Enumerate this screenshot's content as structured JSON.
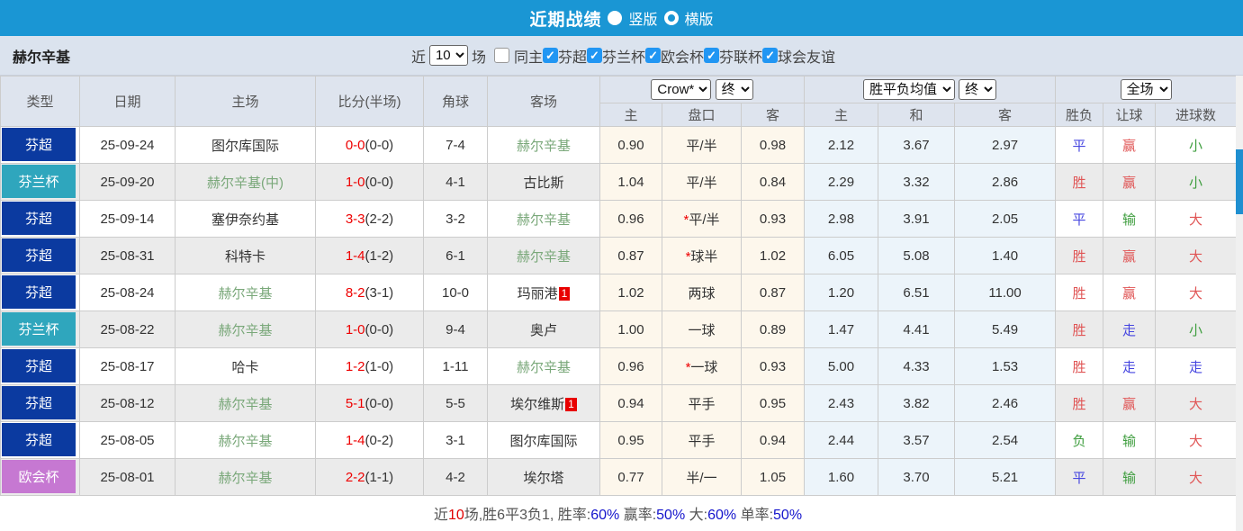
{
  "title_bar": {
    "title": "近期战绩",
    "vertical_label": "竖版",
    "horizontal_label": "横版"
  },
  "filter": {
    "team": "赫尔辛基",
    "recent_label": "近",
    "recent_value": "10",
    "matches_label": "场",
    "same_home_label": "同主",
    "leagues": [
      "芬超",
      "芬兰杯",
      "欧会杯",
      "芬联杯",
      "球会友谊"
    ]
  },
  "colors": {
    "title_bar_bg": "#1a96d4",
    "league_chao_bg": "#0b3aa0",
    "league_bei_bg": "#2fa6bd",
    "league_ou_bg": "#c678d2",
    "checkbox_checked_bg": "#2196f3",
    "ah_odds_col_bg": "#fdf7ec",
    "eu_odds_col_bg": "#ecf4fa"
  },
  "table": {
    "col_headers": [
      "类型",
      "日期",
      "主场",
      "比分(半场)",
      "角球",
      "客场"
    ],
    "sub_headers": [
      "主",
      "盘口",
      "客",
      "主",
      "和",
      "客",
      "胜负",
      "让球",
      "进球数"
    ],
    "dropdowns": {
      "bookmaker": "Crow*",
      "ah_time": "终",
      "europe": "胜平负均值",
      "eu_time": "终",
      "scope": "全场"
    },
    "rows": [
      {
        "type": "芬超",
        "type_key": "chao",
        "date": "25-09-24",
        "home": "图尔库国际",
        "home_green": false,
        "score": "0-0",
        "half": "(0-0)",
        "corner": "7-4",
        "away": "赫尔辛基",
        "away_green": true,
        "away_badge": "",
        "ah": [
          "0.90",
          "平/半",
          "0.98"
        ],
        "ah_star": false,
        "eu": [
          "2.12",
          "3.67",
          "2.97"
        ],
        "res": [
          "平",
          "赢",
          "小"
        ],
        "res_colors": [
          "blue",
          "red",
          "green"
        ]
      },
      {
        "type": "芬兰杯",
        "type_key": "bei",
        "date": "25-09-20",
        "home": "赫尔辛基(中)",
        "home_green": true,
        "score": "1-0",
        "half": "(0-0)",
        "corner": "4-1",
        "away": "古比斯",
        "away_green": false,
        "away_badge": "",
        "ah": [
          "1.04",
          "平/半",
          "0.84"
        ],
        "ah_star": false,
        "eu": [
          "2.29",
          "3.32",
          "2.86"
        ],
        "res": [
          "胜",
          "赢",
          "小"
        ],
        "res_colors": [
          "red",
          "red",
          "green"
        ]
      },
      {
        "type": "芬超",
        "type_key": "chao",
        "date": "25-09-14",
        "home": "塞伊奈约基",
        "home_green": false,
        "score": "3-3",
        "half": "(2-2)",
        "corner": "3-2",
        "away": "赫尔辛基",
        "away_green": true,
        "away_badge": "",
        "ah": [
          "0.96",
          "平/半",
          "0.93"
        ],
        "ah_star": true,
        "eu": [
          "2.98",
          "3.91",
          "2.05"
        ],
        "res": [
          "平",
          "输",
          "大"
        ],
        "res_colors": [
          "blue",
          "green",
          "red"
        ]
      },
      {
        "type": "芬超",
        "type_key": "chao",
        "date": "25-08-31",
        "home": "科特卡",
        "home_green": false,
        "score": "1-4",
        "half": "(1-2)",
        "corner": "6-1",
        "away": "赫尔辛基",
        "away_green": true,
        "away_badge": "",
        "ah": [
          "0.87",
          "球半",
          "1.02"
        ],
        "ah_star": true,
        "eu": [
          "6.05",
          "5.08",
          "1.40"
        ],
        "res": [
          "胜",
          "赢",
          "大"
        ],
        "res_colors": [
          "red",
          "red",
          "red"
        ]
      },
      {
        "type": "芬超",
        "type_key": "chao",
        "date": "25-08-24",
        "home": "赫尔辛基",
        "home_green": true,
        "score": "8-2",
        "half": "(3-1)",
        "corner": "10-0",
        "away": "玛丽港",
        "away_green": false,
        "away_badge": "1",
        "ah": [
          "1.02",
          "两球",
          "0.87"
        ],
        "ah_star": false,
        "eu": [
          "1.20",
          "6.51",
          "11.00"
        ],
        "res": [
          "胜",
          "赢",
          "大"
        ],
        "res_colors": [
          "red",
          "red",
          "red"
        ]
      },
      {
        "type": "芬兰杯",
        "type_key": "bei",
        "date": "25-08-22",
        "home": "赫尔辛基",
        "home_green": true,
        "score": "1-0",
        "half": "(0-0)",
        "corner": "9-4",
        "away": "奥卢",
        "away_green": false,
        "away_badge": "",
        "ah": [
          "1.00",
          "一球",
          "0.89"
        ],
        "ah_star": false,
        "eu": [
          "1.47",
          "4.41",
          "5.49"
        ],
        "res": [
          "胜",
          "走",
          "小"
        ],
        "res_colors": [
          "red",
          "blue",
          "green"
        ]
      },
      {
        "type": "芬超",
        "type_key": "chao",
        "date": "25-08-17",
        "home": "哈卡",
        "home_green": false,
        "score": "1-2",
        "half": "(1-0)",
        "corner": "1-11",
        "away": "赫尔辛基",
        "away_green": true,
        "away_badge": "",
        "ah": [
          "0.96",
          "一球",
          "0.93"
        ],
        "ah_star": true,
        "eu": [
          "5.00",
          "4.33",
          "1.53"
        ],
        "res": [
          "胜",
          "走",
          "走"
        ],
        "res_colors": [
          "red",
          "blue",
          "blue"
        ]
      },
      {
        "type": "芬超",
        "type_key": "chao",
        "date": "25-08-12",
        "home": "赫尔辛基",
        "home_green": true,
        "score": "5-1",
        "half": "(0-0)",
        "corner": "5-5",
        "away": "埃尔维斯",
        "away_green": false,
        "away_badge": "1",
        "ah": [
          "0.94",
          "平手",
          "0.95"
        ],
        "ah_star": false,
        "eu": [
          "2.43",
          "3.82",
          "2.46"
        ],
        "res": [
          "胜",
          "赢",
          "大"
        ],
        "res_colors": [
          "red",
          "red",
          "red"
        ]
      },
      {
        "type": "芬超",
        "type_key": "chao",
        "date": "25-08-05",
        "home": "赫尔辛基",
        "home_green": true,
        "score": "1-4",
        "half": "(0-2)",
        "corner": "3-1",
        "away": "图尔库国际",
        "away_green": false,
        "away_badge": "",
        "ah": [
          "0.95",
          "平手",
          "0.94"
        ],
        "ah_star": false,
        "eu": [
          "2.44",
          "3.57",
          "2.54"
        ],
        "res": [
          "负",
          "输",
          "大"
        ],
        "res_colors": [
          "green",
          "green",
          "red"
        ]
      },
      {
        "type": "欧会杯",
        "type_key": "ou",
        "date": "25-08-01",
        "home": "赫尔辛基",
        "home_green": true,
        "score": "2-2",
        "half": "(1-1)",
        "corner": "4-2",
        "away": "埃尔塔",
        "away_green": false,
        "away_badge": "",
        "ah": [
          "0.77",
          "半/一",
          "1.05"
        ],
        "ah_star": false,
        "eu": [
          "1.60",
          "3.70",
          "5.21"
        ],
        "res": [
          "平",
          "输",
          "大"
        ],
        "res_colors": [
          "blue",
          "green",
          "red"
        ]
      }
    ]
  },
  "footer": {
    "parts": [
      {
        "text": "近",
        "color": "gray"
      },
      {
        "text": "10",
        "color": "red"
      },
      {
        "text": "场,胜6平3负1, 胜率:",
        "color": "gray"
      },
      {
        "text": "60%",
        "color": "blue"
      },
      {
        "text": " 赢率:",
        "color": "gray"
      },
      {
        "text": "50%",
        "color": "blue"
      },
      {
        "text": " 大:",
        "color": "gray"
      },
      {
        "text": "60%",
        "color": "blue"
      },
      {
        "text": " 单率:",
        "color": "gray"
      },
      {
        "text": "50%",
        "color": "blue"
      }
    ]
  }
}
